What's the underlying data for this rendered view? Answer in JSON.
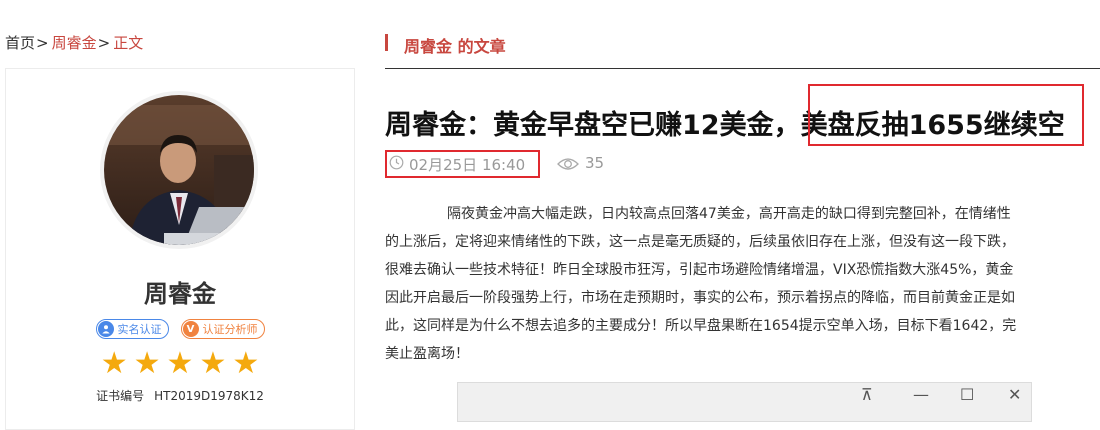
{
  "breadcrumb": {
    "home": "首页",
    "author": "周睿金",
    "current": "正文",
    "separator": ">"
  },
  "profile": {
    "name": "周睿金",
    "badges": [
      {
        "label": "实名认证",
        "icon": "user-icon",
        "color": "#4a88e8"
      },
      {
        "label": "认证分析师",
        "icon": "v-icon",
        "color": "#f08340"
      }
    ],
    "rating": 5,
    "cert_label": "证书编号",
    "cert_number": "HT2019D1978K12"
  },
  "section": {
    "title": "周睿金 的文章",
    "accent_color": "#c8473f"
  },
  "article": {
    "title": "周睿金：黄金早盘空已赚12美金，美盘反抽1655继续空",
    "date": "02月25日 16:40",
    "views": "35",
    "body_lines": [
      "隔夜黄金冲高大幅走跌，日内较高点回落47美金，高开高走的缺口得到完整回补，在情绪性",
      "的上涨后，定将迎来情绪性的下跌，这一点是毫无质疑的，后续虽依旧存在上涨，但没有这一段下跌，",
      "很难去确认一些技术特征！昨日全球股市狂泻，引起市场避险情绪增温，VIX恐慌指数大涨45%，黄金",
      "因此开启最后一阶段强势上行，市场在走预期时，事实的公布，预示着拐点的降临，而目前黄金正是如",
      "此，这同样是为什么不想去追多的主要成分！所以早盘果断在1654提示空单入场，目标下看1642，完",
      "美止盈离场！"
    ]
  },
  "embed_window": {
    "controls": [
      "⊼",
      "—",
      "☐",
      "✕"
    ]
  }
}
